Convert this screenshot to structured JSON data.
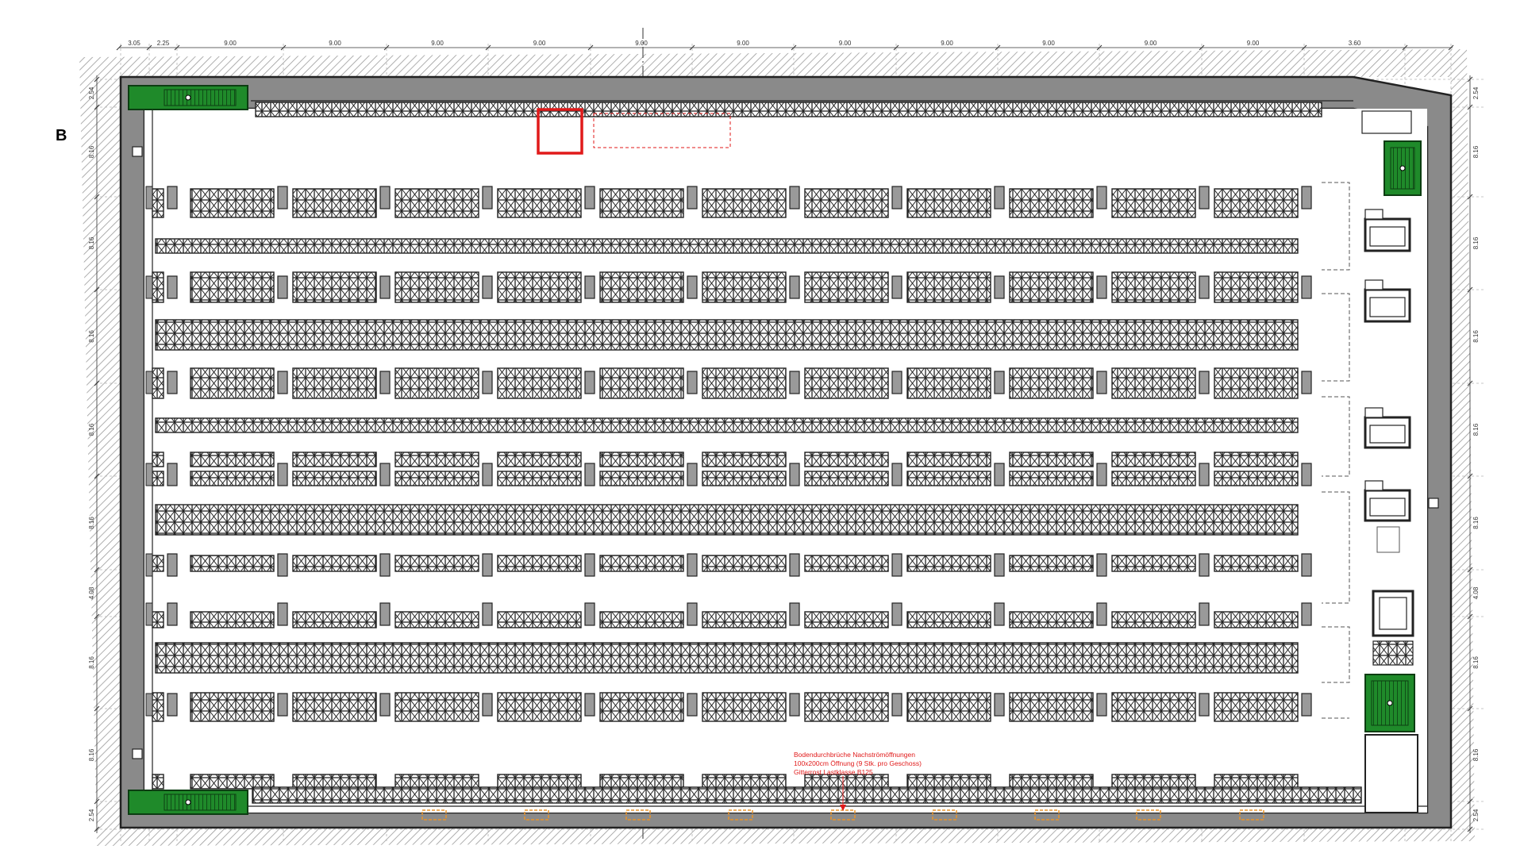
{
  "drawing": {
    "section_marker": "B",
    "dimensions_top": [
      "3.05",
      "2.25",
      "9.00",
      "9.00",
      "9.00",
      "9.00",
      "9.00",
      "9.00",
      "9.00",
      "9.00",
      "9.00",
      "9.00",
      "9.00",
      "3.60"
    ],
    "dimensions_side": [
      "2.54",
      "8.16",
      "8.16",
      "8.16",
      "8.16",
      "8.16",
      "4.08",
      "8.16",
      "8.16",
      "2.54"
    ],
    "annotation": {
      "lines": [
        "Bodendurchbrüche Nachströmöffnungen",
        "100x200cm Öffnung (9 Stk. pro Geschoss)",
        "Gitterrost Lastklasse B125"
      ]
    },
    "colors": {
      "wall": "#8a8a8a",
      "wall_outline": "#222222",
      "stair_core": "#1f8a2a",
      "highlight": "#e11a1a",
      "floor_opening": "#e8932a",
      "rack_line": "#222222",
      "grid_line": "#b5b5b5",
      "hatch": "#9a9a9a"
    }
  }
}
